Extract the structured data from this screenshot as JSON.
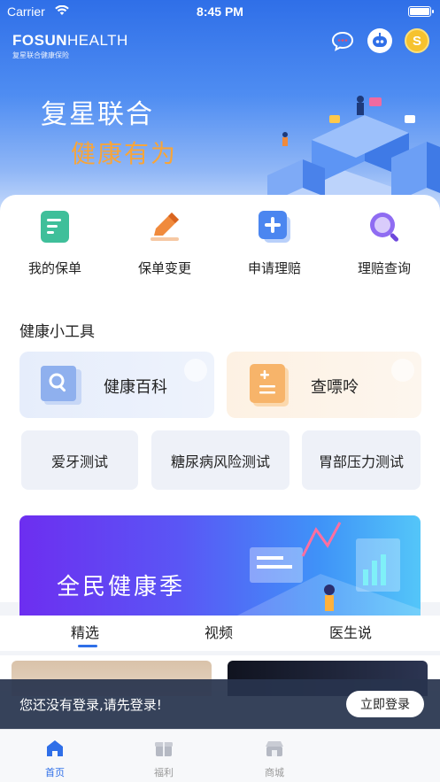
{
  "status_bar": {
    "carrier": "Carrier",
    "time": "8:45 PM"
  },
  "header": {
    "logo_main_bold": "FOSUN",
    "logo_main_light": "HEALTH",
    "logo_sub": "复星联合健康保险",
    "icons": [
      "chat-bubble-icon",
      "robot-service-icon",
      "coin-icon"
    ],
    "coin_label": "S"
  },
  "hero": {
    "slogan_line1": "复星联合",
    "slogan_line2": "健康有为",
    "slogan2_color": "#f7a53a"
  },
  "quick_actions": [
    {
      "label": "我的保单",
      "icon": "policy-doc-icon",
      "color": "#3fbf9a"
    },
    {
      "label": "保单变更",
      "icon": "edit-pen-icon",
      "color": "#f08a3c"
    },
    {
      "label": "申请理赔",
      "icon": "plus-square-icon",
      "color": "#4b86f0"
    },
    {
      "label": "理赔查询",
      "icon": "magnifier-icon",
      "color": "#8f6cf2"
    }
  ],
  "tools": {
    "title": "健康小工具",
    "big": [
      {
        "label": "健康百科",
        "icon": "encyclopedia-book-icon"
      },
      {
        "label": "查嘌呤",
        "icon": "calculator-icon"
      }
    ],
    "small": [
      "爱牙测试",
      "糖尿病风险测试",
      "胃部压力测试"
    ]
  },
  "banner": {
    "text": "全民健康季"
  },
  "content_tabs": {
    "items": [
      "精选",
      "视频",
      "医生说"
    ],
    "active": "精选"
  },
  "login_prompt": {
    "message": "您还没有登录,请先登录!",
    "button": "立即登录"
  },
  "bottom_nav": {
    "items": [
      {
        "label": "首页",
        "icon": "home-icon",
        "active": true
      },
      {
        "label": "福利",
        "icon": "gift-box-icon",
        "active": false
      },
      {
        "label": "商城",
        "icon": "shop-icon",
        "active": false
      }
    ]
  },
  "colors": {
    "accent": "#2f6fe8",
    "hero_top": "#2f6fe8",
    "login_bar": "#28344e"
  }
}
